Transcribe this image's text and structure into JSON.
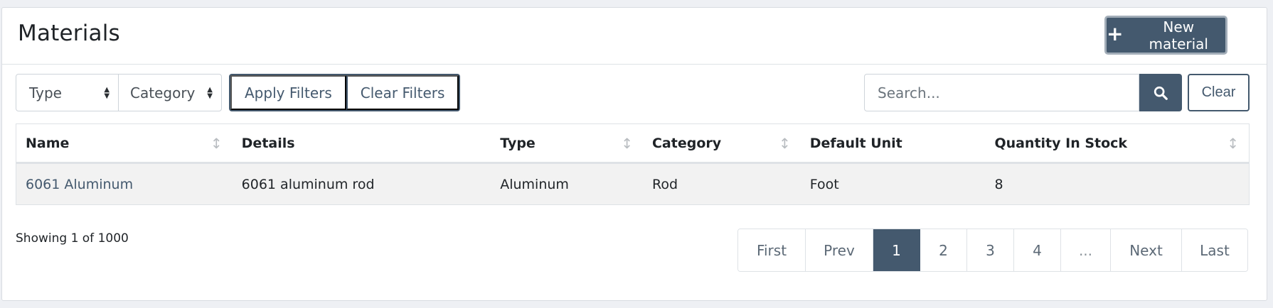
{
  "header": {
    "title": "Materials",
    "new_button_label": "New material"
  },
  "filters": {
    "type_select": "Type",
    "category_select": "Category",
    "apply_label": "Apply Filters",
    "clear_filters_label": "Clear Filters"
  },
  "search": {
    "placeholder": "Search...",
    "clear_label": "Clear"
  },
  "table": {
    "columns": [
      "Name",
      "Details",
      "Type",
      "Category",
      "Default Unit",
      "Quantity In Stock"
    ],
    "rows": [
      {
        "name": "6061 Aluminum",
        "details": "6061 aluminum rod",
        "type": "Aluminum",
        "category": "Rod",
        "default_unit": "Foot",
        "quantity": "8"
      }
    ]
  },
  "footer": {
    "showing": "Showing 1 of 1000"
  },
  "pagination": {
    "first": "First",
    "prev": "Prev",
    "pages": [
      "1",
      "2",
      "3",
      "4"
    ],
    "ellipsis": "...",
    "next": "Next",
    "last": "Last",
    "active_page": "1"
  },
  "icons": {
    "plus": "plus-icon",
    "search": "search-icon",
    "sort": "sort-icon"
  },
  "colors": {
    "primary": "#44596e",
    "row_bg": "#f2f2f2"
  }
}
